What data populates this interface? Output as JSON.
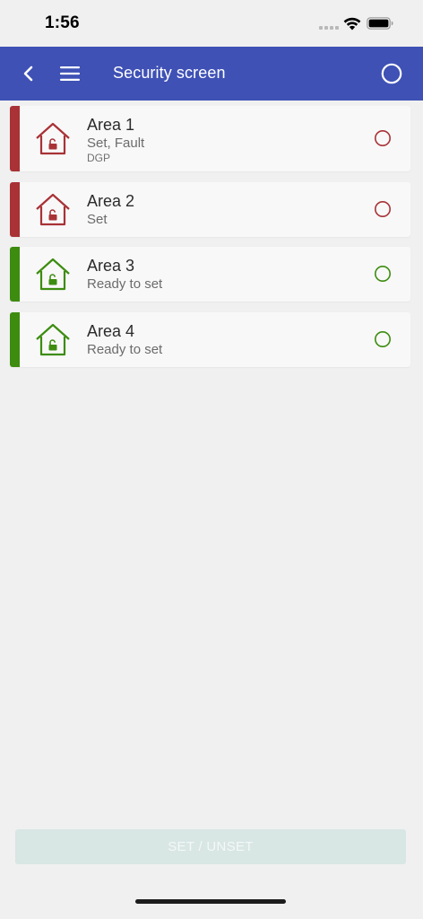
{
  "status_bar": {
    "time": "1:56",
    "icons": [
      "signal-dots-icon",
      "wifi-icon",
      "battery-icon"
    ]
  },
  "header": {
    "title": "Security screen",
    "background_color": "#3f51b5",
    "icons": [
      "back-chevron-icon",
      "hamburger-menu-icon",
      "status-circle-icon"
    ]
  },
  "areas": [
    {
      "name": "Area 1",
      "status": "Set, Fault",
      "sub": "DGP",
      "color": "#a83236",
      "icon": "house-lock-icon"
    },
    {
      "name": "Area 2",
      "status": "Set",
      "sub": "",
      "color": "#a83236",
      "icon": "house-lock-icon"
    },
    {
      "name": "Area 3",
      "status": "Ready to set",
      "sub": "",
      "color": "#3d8c10",
      "icon": "house-lock-icon"
    },
    {
      "name": "Area 4",
      "status": "Ready to set",
      "sub": "",
      "color": "#3d8c10",
      "icon": "house-lock-icon"
    }
  ],
  "footer": {
    "button_label": "SET / UNSET"
  }
}
